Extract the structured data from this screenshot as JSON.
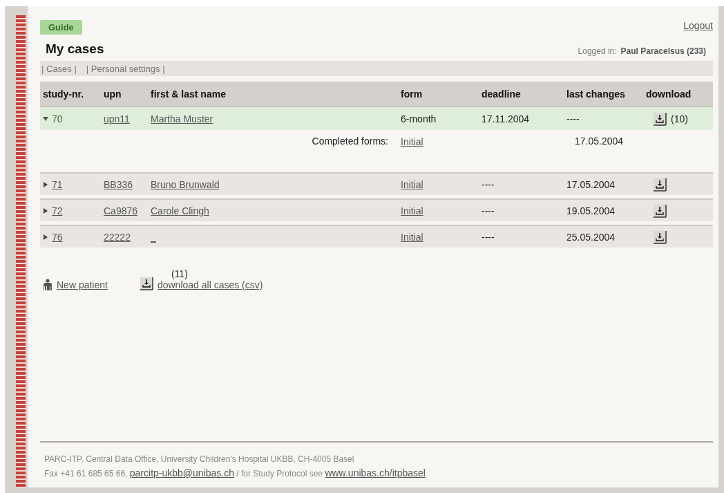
{
  "guide_button": "Guide",
  "logout_link": "Logout",
  "page_title": "My cases",
  "logged_in": {
    "label": "Logged in:",
    "user": "Paul Paracelsus (233)"
  },
  "nav_links": [
    {
      "label": "| Cases |",
      "selected": false
    },
    {
      "label": "| Personal settings |",
      "selected": false
    }
  ],
  "table": {
    "columns": [
      "study-nr.",
      "upn",
      "first & last name",
      "form",
      "deadline",
      "last changes",
      "download"
    ],
    "rows": [
      {
        "study_nr": "70",
        "upn": "upn11",
        "name": "Martha Muster",
        "form": "6-month",
        "deadline": "17.11.2004",
        "last_changes": "----",
        "expanded": true,
        "download_note": "(10)",
        "completed": {
          "label": "Completed forms:",
          "form": "Initial",
          "date": "17.05.2004"
        }
      },
      {
        "study_nr": "71",
        "upn": "BB336",
        "name": "Bruno Brunwald",
        "form": "Initial",
        "deadline": "----",
        "last_changes": "17.05.2004",
        "expanded": false
      },
      {
        "study_nr": "72",
        "upn": "Ca9876",
        "name": "Carole Clingh",
        "form": "Initial",
        "deadline": "----",
        "last_changes": "19.05.2004",
        "expanded": false
      },
      {
        "study_nr": "76",
        "upn": "22222",
        "name": "_",
        "form": "Initial",
        "deadline": "----",
        "last_changes": "25.05.2004",
        "expanded": false
      }
    ]
  },
  "actions": {
    "new_patient": "New patient",
    "download_all": "download all cases (csv)",
    "download_all_note": "(11)"
  },
  "footer": {
    "line1": "PARC-ITP, Central Data Office, University Children's Hospital UKBB, CH-4005 Basel",
    "fax": "Fax +41 61 685 65 66,",
    "email": "parcitp-ukbb@unibas.ch",
    "protocol_text": "/ for Study Protocol see",
    "website": "www.unibas.ch/itpbasel"
  }
}
